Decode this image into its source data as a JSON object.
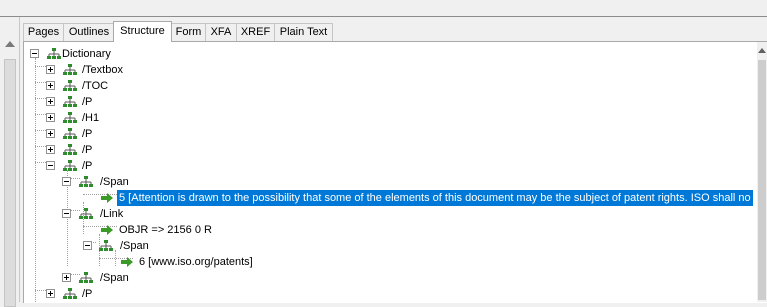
{
  "tabs": [
    {
      "label": "Pages"
    },
    {
      "label": "Outlines"
    },
    {
      "label": "Structure",
      "active": true
    },
    {
      "label": "Form"
    },
    {
      "label": "XFA"
    },
    {
      "label": "XREF"
    },
    {
      "label": "Plain Text"
    }
  ],
  "tree": {
    "root": "Dictionary",
    "nodes": [
      {
        "label": "/Textbox",
        "expander": "plus",
        "icon": "structure-node-icon"
      },
      {
        "label": "/TOC",
        "expander": "plus",
        "icon": "structure-node-icon"
      },
      {
        "label": "/P",
        "expander": "plus",
        "icon": "structure-node-icon"
      },
      {
        "label": "/H1",
        "expander": "plus",
        "icon": "structure-node-icon"
      },
      {
        "label": "/P",
        "expander": "plus",
        "icon": "structure-node-icon"
      },
      {
        "label": "/P",
        "expander": "plus",
        "icon": "structure-node-icon"
      },
      {
        "label": "/P",
        "expander": "minus",
        "icon": "structure-node-icon"
      },
      {
        "label": "/Span",
        "expander": "minus",
        "icon": "structure-node-icon"
      },
      {
        "label": "5 [Attention is drawn to the possibility that some of the elements of this document may be the subject of patent rights. ISO shall no",
        "icon": "content-arrow-icon",
        "selected": true
      },
      {
        "label": "/Link",
        "expander": "minus",
        "icon": "structure-node-icon"
      },
      {
        "label": "OBJR => 2156 0 R",
        "icon": "content-arrow-icon"
      },
      {
        "label": "/Span",
        "expander": "minus",
        "icon": "structure-node-icon"
      },
      {
        "label": "6 [www.iso.org/patents]",
        "icon": "content-arrow-icon"
      },
      {
        "label": "/Span",
        "expander": "plus",
        "icon": "structure-node-icon"
      },
      {
        "label": "/P",
        "expander": "plus",
        "icon": "structure-node-icon"
      }
    ]
  },
  "colors": {
    "selection": "#0078d7",
    "node_icon": "#2e8b2e",
    "arrow_icon": "#3c9a28"
  }
}
